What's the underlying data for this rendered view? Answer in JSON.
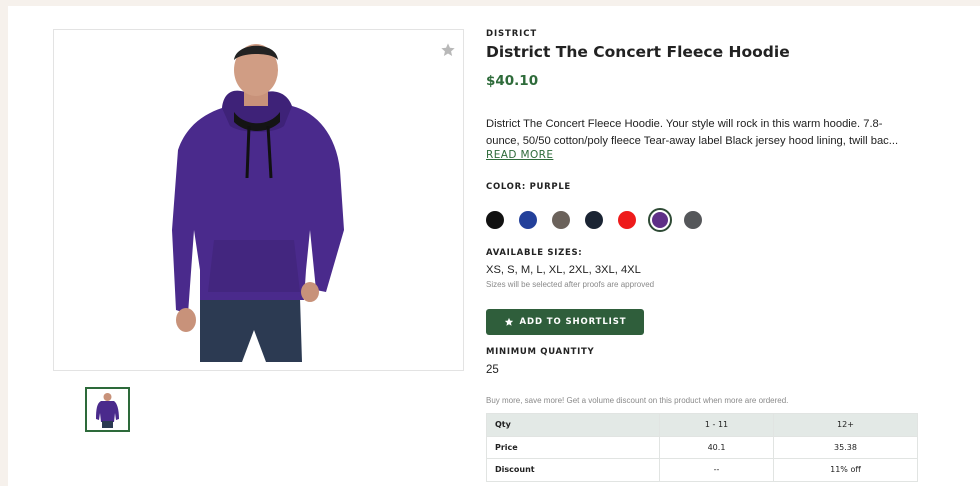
{
  "product": {
    "brand": "DISTRICT",
    "title": "District The Concert Fleece Hoodie",
    "price": "$40.10",
    "description_lines": [
      "District The Concert Fleece Hoodie. Your style will rock in this warm hoodie. 7.8-",
      "ounce, 50/50 cotton/poly fleece Tear-away label Black jersey hood lining, twill bac..."
    ],
    "read_more": "READ MORE"
  },
  "color": {
    "label": "COLOR: PURPLE",
    "swatches": [
      {
        "name": "black",
        "hex": "#111111",
        "selected": false
      },
      {
        "name": "royal",
        "hex": "#23409a",
        "selected": false
      },
      {
        "name": "grey-brown",
        "hex": "#6b625b",
        "selected": false
      },
      {
        "name": "navy",
        "hex": "#1a2433",
        "selected": false
      },
      {
        "name": "red",
        "hex": "#ee1b1b",
        "selected": false
      },
      {
        "name": "purple",
        "hex": "#5f2f87",
        "selected": true
      },
      {
        "name": "charcoal",
        "hex": "#55575a",
        "selected": false
      }
    ]
  },
  "sizes": {
    "label": "AVAILABLE SIZES:",
    "values": "XS, S, M, L, XL, 2XL, 3XL, 4XL",
    "note": "Sizes will be selected after proofs are approved"
  },
  "shortlist_button": {
    "label": "ADD TO SHORTLIST",
    "icon": "star-icon"
  },
  "min_quantity": {
    "label": "MINIMUM QUANTITY",
    "value": "25"
  },
  "volume": {
    "note": "Buy more, save more! Get a volume discount on this product when more are ordered.",
    "headers": [
      "Qty",
      "1 - 11",
      "12+"
    ],
    "rows": [
      [
        "Price",
        "40.1",
        "35.38"
      ],
      [
        "Discount",
        "--",
        "11% off"
      ]
    ]
  },
  "colors": {
    "accent_green": "#2e6b3a",
    "button_green": "#2f5e3b",
    "hoodie_purple": "#4a2a8c"
  }
}
